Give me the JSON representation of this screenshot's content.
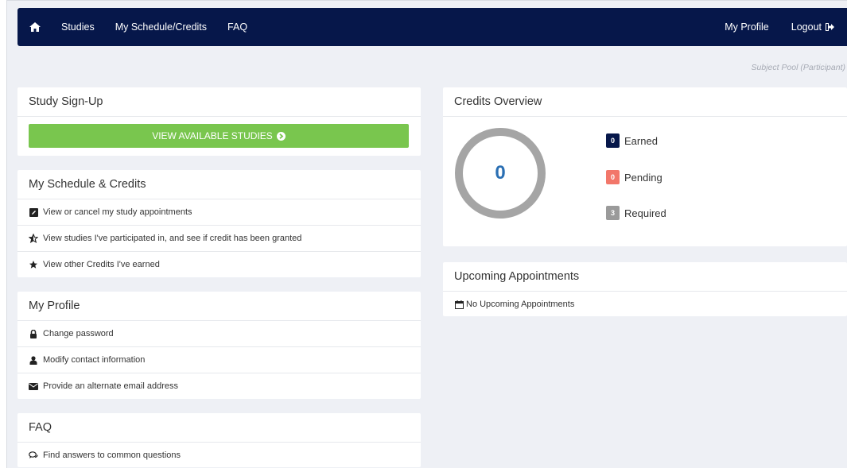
{
  "nav": {
    "home_icon": "home-icon",
    "studies": "Studies",
    "schedule": "My Schedule/Credits",
    "faq": "FAQ",
    "profile": "My Profile",
    "logout": "Logout",
    "logout_icon": "sign-out-icon"
  },
  "subtitle": "Subject Pool (Participant)",
  "signup": {
    "title": "Study Sign-Up",
    "button": "VIEW AVAILABLE STUDIES",
    "button_icon": "circle-arrow-right-icon",
    "button_color": "#79c64e"
  },
  "schedule": {
    "title": "My Schedule & Credits",
    "items": [
      {
        "label": "View or cancel my study appointments",
        "icon": "edit-icon"
      },
      {
        "label": "View studies I've participated in, and see if credit has been granted",
        "icon": "half-star-icon"
      },
      {
        "label": "View other Credits I've earned",
        "icon": "star-icon"
      }
    ]
  },
  "profile": {
    "title": "My Profile",
    "items": [
      {
        "label": "Change password",
        "icon": "lock-icon"
      },
      {
        "label": "Modify contact information",
        "icon": "user-icon"
      },
      {
        "label": "Provide an alternate email address",
        "icon": "envelope-icon"
      }
    ]
  },
  "faq": {
    "title": "FAQ",
    "items": [
      {
        "label": "Find answers to common questions",
        "icon": "comments-icon"
      }
    ]
  },
  "credits": {
    "title": "Credits Overview",
    "total": "0",
    "earned": {
      "value": "0",
      "label": "Earned",
      "color": "#06174a"
    },
    "pending": {
      "value": "0",
      "label": "Pending",
      "color": "#f2776a"
    },
    "required": {
      "value": "3",
      "label": "Required",
      "color": "#9a9a9a"
    }
  },
  "appointments": {
    "title": "Upcoming Appointments",
    "empty_text": "No Upcoming Appointments",
    "icon": "calendar-icon"
  },
  "colors": {
    "navbar": "#06174a",
    "background": "#eef0f5",
    "donut": "#a5a5a5",
    "donut_number": "#2a6fb3"
  }
}
